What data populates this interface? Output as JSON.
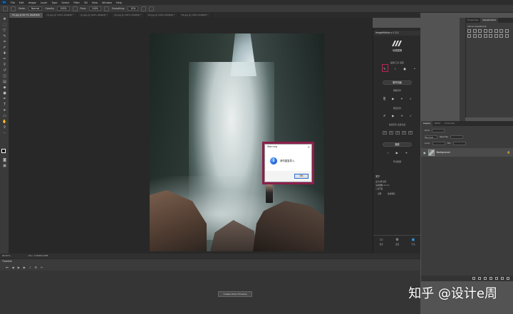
{
  "menu": [
    "File",
    "Edit",
    "Image",
    "Layer",
    "Type",
    "Select",
    "Filter",
    "3D",
    "View",
    "Window",
    "Help"
  ],
  "options": {
    "mode_label": "Mode:",
    "mode_value": "Normal",
    "opacity_label": "Opacity:",
    "opacity_value": "100%",
    "flow_label": "Flow:",
    "flow_value": "100%",
    "smoothing_label": "Smoothing:",
    "smoothing_value": "10%"
  },
  "tabs": [
    "03.jpg @ 66.7% (RGB/8#)",
    "(1).jpg @ 100% (RGB/8) *",
    "(2).jpg @ 100% (RGB/8) *",
    "(3).jpg @ 100% (RGB/8) *",
    "04.jpg @ 100% (RGB/8) *",
    "05.jpg @ 100% (RGB/8) *"
  ],
  "dialog": {
    "title": "Warning",
    "close": "×",
    "icon": "i",
    "message": "请勿重复导入",
    "ok": "OK"
  },
  "plugin": {
    "title": "ImageMotion v 1.2.1",
    "brand": "动感图像",
    "brush_label": "画笔工具 选区",
    "action_button": "制作动画",
    "section1": "图像控件",
    "section2": "图层控件",
    "section3": "蒙版控件 设置动画",
    "frames": [
      "1",
      "2",
      "3",
      "4",
      "5"
    ],
    "preview_button": "播放",
    "preview_sub": "导出视频",
    "about_title": "关于",
    "about_lines": [
      "设计e周 插件",
      "动感图像 v1.2.1",
      "二次开发"
    ],
    "about_links": [
      "官网",
      "使用教程"
    ],
    "bottom": [
      {
        "icon": "monitor-icon",
        "label": "预览"
      },
      {
        "icon": "gear-icon",
        "label": "设置"
      },
      {
        "icon": "save-icon",
        "label": "导出"
      }
    ]
  },
  "adjustments": {
    "tabs": [
      "Properties",
      "Adjustments"
    ],
    "add_label": "Add an adjustment"
  },
  "layers": {
    "tabs": [
      "Layers",
      "Paths",
      "Channels"
    ],
    "kind_label": "Kind",
    "blend_value": "Normal",
    "opacity_label": "Opacity:",
    "lock_label": "Lock:",
    "fill_label": "Fill:",
    "layer_name": "Background",
    "layer_lock": "🔒"
  },
  "status": {
    "zoom": "66.67%",
    "doc": "Doc: 3.00M/3.00M"
  },
  "timeline": {
    "title": "Timeline",
    "create_button": "Create Video Timeline"
  },
  "watermark": "知乎 @设计e周"
}
